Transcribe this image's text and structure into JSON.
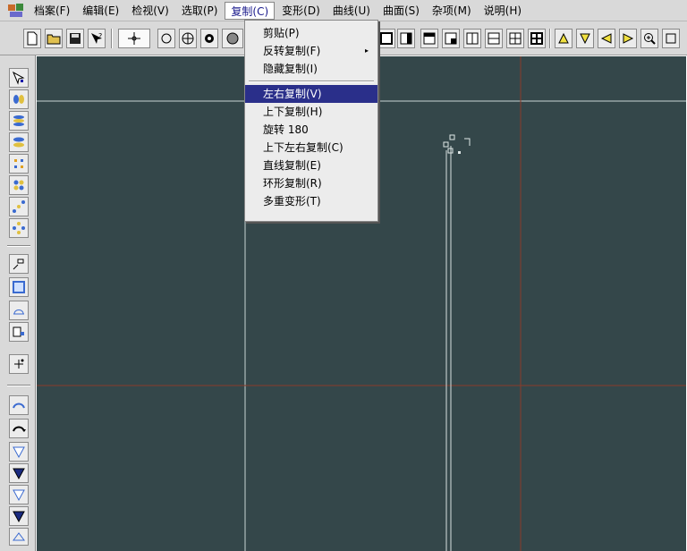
{
  "menubar": {
    "items": [
      {
        "label": "档案(F)"
      },
      {
        "label": "编辑(E)"
      },
      {
        "label": "检视(V)"
      },
      {
        "label": "选取(P)"
      },
      {
        "label": "复制(C)"
      },
      {
        "label": "变形(D)"
      },
      {
        "label": "曲线(U)"
      },
      {
        "label": "曲面(S)"
      },
      {
        "label": "杂项(M)"
      },
      {
        "label": "说明(H)"
      }
    ]
  },
  "dropdown": {
    "items": [
      {
        "label": "剪贴(P)"
      },
      {
        "label": "反转复制(F)",
        "submenu": "▸"
      },
      {
        "label": "隐藏复制(I)"
      },
      {
        "label": "左右复制(V)"
      },
      {
        "label": "上下复制(H)"
      },
      {
        "label": "旋转 180"
      },
      {
        "label": "上下左右复制(C)"
      },
      {
        "label": "直线复制(E)"
      },
      {
        "label": "环形复制(R)"
      },
      {
        "label": "多重变形(T)"
      }
    ]
  },
  "colors": {
    "viewport_bg": "#34474a",
    "highlight": "#2a2f8a",
    "axis_line": "#8a3b2a",
    "guide_line": "#c8d4d4"
  },
  "icons": {
    "app": "app-logo-icon"
  }
}
